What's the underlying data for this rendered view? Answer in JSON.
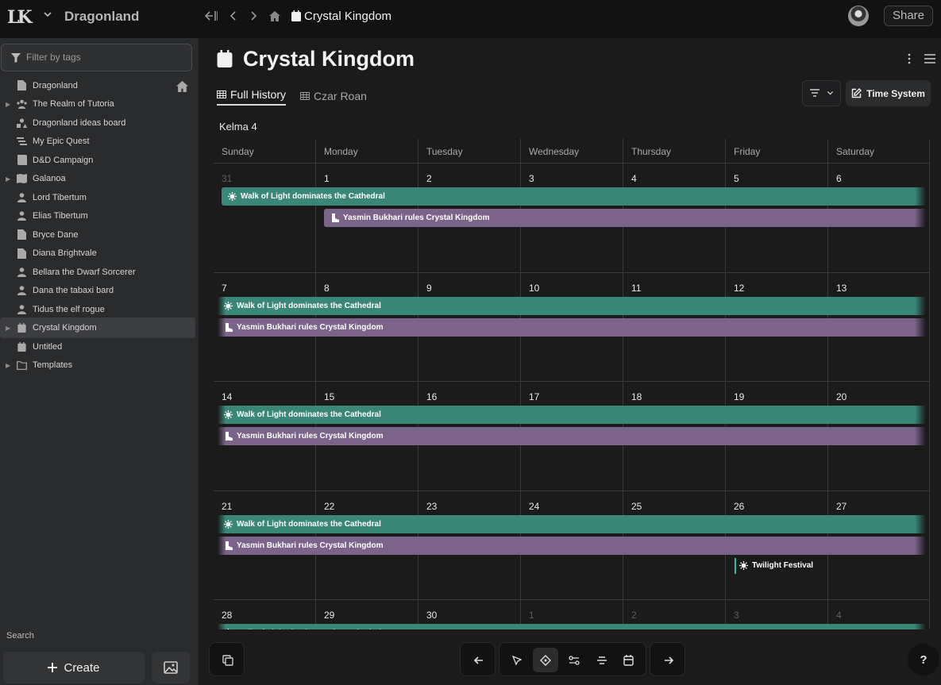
{
  "workspace": {
    "logo": "LK",
    "name": "Dragonland"
  },
  "topbar": {
    "page_title": "Crystal Kingdom",
    "share_label": "Share"
  },
  "sidebar": {
    "filter_placeholder": "Filter by tags",
    "items": [
      {
        "label": "Dragonland",
        "icon": "document-icon",
        "expandable": false
      },
      {
        "label": "The Realm of Tutoria",
        "icon": "people-group-icon",
        "expandable": true
      },
      {
        "label": "Dragonland ideas board",
        "icon": "shapes-icon",
        "expandable": false
      },
      {
        "label": "My Epic Quest",
        "icon": "quest-icon",
        "expandable": false
      },
      {
        "label": "D&D Campaign",
        "icon": "book-icon",
        "expandable": false
      },
      {
        "label": "Galanoa",
        "icon": "map-icon",
        "expandable": true
      },
      {
        "label": "Lord Tibertum",
        "icon": "person-icon",
        "expandable": false
      },
      {
        "label": "Elias Tibertum",
        "icon": "person-icon",
        "expandable": false
      },
      {
        "label": "Bryce Dane",
        "icon": "document-icon",
        "expandable": false
      },
      {
        "label": "Diana Brightvale",
        "icon": "document-icon",
        "expandable": false
      },
      {
        "label": "Bellara the Dwarf Sorcerer",
        "icon": "person-icon",
        "expandable": false
      },
      {
        "label": "Dana the tabaxi bard",
        "icon": "person-icon",
        "expandable": false
      },
      {
        "label": "Tidus the elf rogue",
        "icon": "person-icon",
        "expandable": false
      },
      {
        "label": "Crystal Kingdom",
        "icon": "calendar-icon",
        "expandable": true,
        "selected": true
      },
      {
        "label": "Untitled",
        "icon": "calendar-icon",
        "expandable": false
      },
      {
        "label": "Templates",
        "icon": "folder-icon",
        "expandable": true
      }
    ],
    "search_label": "Search",
    "create_label": "Create"
  },
  "page": {
    "title": "Crystal Kingdom",
    "tabs": [
      {
        "label": "Full History",
        "active": true
      },
      {
        "label": "Czar Roan",
        "active": false
      }
    ],
    "time_system_label": "Time System",
    "month_label": "Kelma 4"
  },
  "calendar": {
    "weekdays": [
      "Sunday",
      "Monday",
      "Tuesday",
      "Wednesday",
      "Thursday",
      "Friday",
      "Saturday"
    ],
    "weeks": [
      {
        "days": [
          {
            "n": "31",
            "other": true
          },
          {
            "n": "1"
          },
          {
            "n": "2"
          },
          {
            "n": "3"
          },
          {
            "n": "4"
          },
          {
            "n": "5"
          },
          {
            "n": "6"
          }
        ]
      },
      {
        "days": [
          {
            "n": "7"
          },
          {
            "n": "8"
          },
          {
            "n": "9"
          },
          {
            "n": "10"
          },
          {
            "n": "11"
          },
          {
            "n": "12"
          },
          {
            "n": "13"
          }
        ]
      },
      {
        "days": [
          {
            "n": "14"
          },
          {
            "n": "15"
          },
          {
            "n": "16"
          },
          {
            "n": "17"
          },
          {
            "n": "18"
          },
          {
            "n": "19"
          },
          {
            "n": "20"
          }
        ]
      },
      {
        "days": [
          {
            "n": "21"
          },
          {
            "n": "22"
          },
          {
            "n": "23"
          },
          {
            "n": "24"
          },
          {
            "n": "25"
          },
          {
            "n": "26"
          },
          {
            "n": "27"
          }
        ]
      },
      {
        "days": [
          {
            "n": "28"
          },
          {
            "n": "29"
          },
          {
            "n": "30"
          },
          {
            "n": "1",
            "other": true
          },
          {
            "n": "2",
            "other": true
          },
          {
            "n": "3",
            "other": true
          },
          {
            "n": "4",
            "other": true
          }
        ]
      }
    ],
    "events": {
      "walk_of_light": "Walk of Light dominates the Cathedral",
      "yasmin": "Yasmin Bukhari rules Crystal Kingdom",
      "twilight": "Twilight Festival"
    },
    "colors": {
      "teal": "#3a8678",
      "purple": "#7b6389",
      "festival_accent": "#3fb6a5"
    }
  },
  "help_label": "?"
}
